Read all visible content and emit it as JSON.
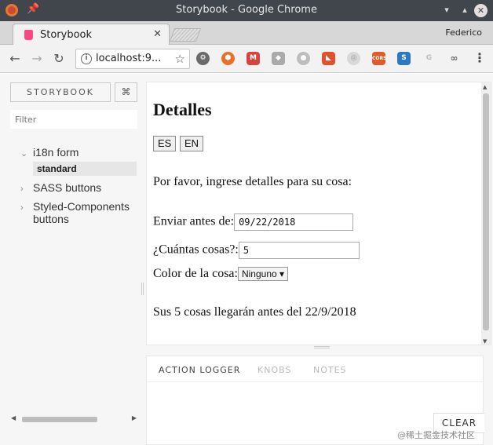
{
  "window": {
    "title": "Storybook - Google Chrome",
    "profile": "Federico"
  },
  "tab": {
    "label": "Storybook"
  },
  "toolbar": {
    "url": "localhost:9..."
  },
  "sidebar": {
    "brand": "STORYBOOK",
    "shortcut": "⌘",
    "filter_placeholder": "Filter",
    "kinds": [
      {
        "label": "i18n form",
        "expanded": true
      },
      {
        "label": "SASS buttons",
        "expanded": false
      },
      {
        "label": "Styled-Components buttons",
        "expanded": false
      }
    ],
    "selected_story": "standard"
  },
  "preview": {
    "title": "Detalles",
    "lang_buttons": [
      "ES",
      "EN"
    ],
    "intro": "Por favor, ingrese detalles para su cosa:",
    "deliver_label": "Enviar antes de:",
    "deliver_value": "09/22/2018",
    "quantity_label": "¿Cuántas cosas?:",
    "quantity_value": "5",
    "color_label": "Color de la cosa:",
    "color_value": "Ninguno",
    "summary": "Sus 5 cosas llegarán antes del 22/9/2018"
  },
  "addons": {
    "tabs": [
      "ACTION LOGGER",
      "KNOBS",
      "NOTES"
    ],
    "active_tab": "ACTION LOGGER",
    "clear_label": "CLEAR"
  },
  "watermark": "@稀土掘金技术社区",
  "colors": {
    "titlebar": "#40464c",
    "favicon": "#ff4785"
  }
}
